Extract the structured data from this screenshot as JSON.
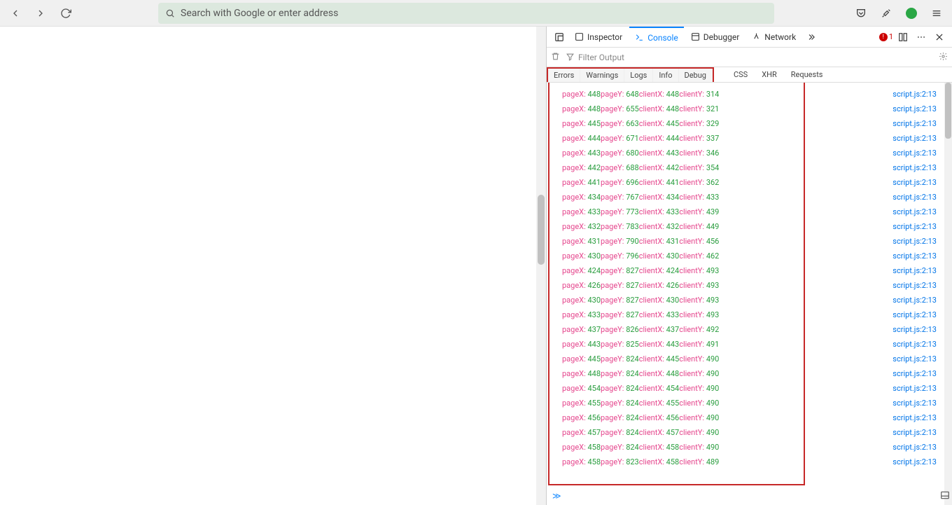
{
  "browser": {
    "url_placeholder": "Search with Google or enter address"
  },
  "devtools": {
    "tabs": {
      "inspector": "Inspector",
      "console": "Console",
      "debugger": "Debugger",
      "network": "Network"
    },
    "error_count": "1",
    "filter_placeholder": "Filter Output",
    "categories": {
      "errors": "Errors",
      "warnings": "Warnings",
      "logs": "Logs",
      "info": "Info",
      "debug": "Debug",
      "css": "CSS",
      "xhr": "XHR",
      "requests": "Requests"
    },
    "source_link": "script.js:2:13",
    "prompt": "≫",
    "logs": [
      {
        "pageX": 448,
        "pageY": 648,
        "clientX": 448,
        "clientY": 314
      },
      {
        "pageX": 448,
        "pageY": 655,
        "clientX": 448,
        "clientY": 321
      },
      {
        "pageX": 445,
        "pageY": 663,
        "clientX": 445,
        "clientY": 329
      },
      {
        "pageX": 444,
        "pageY": 671,
        "clientX": 444,
        "clientY": 337
      },
      {
        "pageX": 443,
        "pageY": 680,
        "clientX": 443,
        "clientY": 346
      },
      {
        "pageX": 442,
        "pageY": 688,
        "clientX": 442,
        "clientY": 354
      },
      {
        "pageX": 441,
        "pageY": 696,
        "clientX": 441,
        "clientY": 362
      },
      {
        "pageX": 434,
        "pageY": 767,
        "clientX": 434,
        "clientY": 433
      },
      {
        "pageX": 433,
        "pageY": 773,
        "clientX": 433,
        "clientY": 439
      },
      {
        "pageX": 432,
        "pageY": 783,
        "clientX": 432,
        "clientY": 449
      },
      {
        "pageX": 431,
        "pageY": 790,
        "clientX": 431,
        "clientY": 456
      },
      {
        "pageX": 430,
        "pageY": 796,
        "clientX": 430,
        "clientY": 462
      },
      {
        "pageX": 424,
        "pageY": 827,
        "clientX": 424,
        "clientY": 493
      },
      {
        "pageX": 426,
        "pageY": 827,
        "clientX": 426,
        "clientY": 493
      },
      {
        "pageX": 430,
        "pageY": 827,
        "clientX": 430,
        "clientY": 493
      },
      {
        "pageX": 433,
        "pageY": 827,
        "clientX": 433,
        "clientY": 493
      },
      {
        "pageX": 437,
        "pageY": 826,
        "clientX": 437,
        "clientY": 492
      },
      {
        "pageX": 443,
        "pageY": 825,
        "clientX": 443,
        "clientY": 491
      },
      {
        "pageX": 445,
        "pageY": 824,
        "clientX": 445,
        "clientY": 490
      },
      {
        "pageX": 448,
        "pageY": 824,
        "clientX": 448,
        "clientY": 490
      },
      {
        "pageX": 454,
        "pageY": 824,
        "clientX": 454,
        "clientY": 490
      },
      {
        "pageX": 455,
        "pageY": 824,
        "clientX": 455,
        "clientY": 490
      },
      {
        "pageX": 456,
        "pageY": 824,
        "clientX": 456,
        "clientY": 490
      },
      {
        "pageX": 457,
        "pageY": 824,
        "clientX": 457,
        "clientY": 490
      },
      {
        "pageX": 458,
        "pageY": 824,
        "clientX": 458,
        "clientY": 490
      },
      {
        "pageX": 458,
        "pageY": 823,
        "clientX": 458,
        "clientY": 489
      }
    ]
  }
}
